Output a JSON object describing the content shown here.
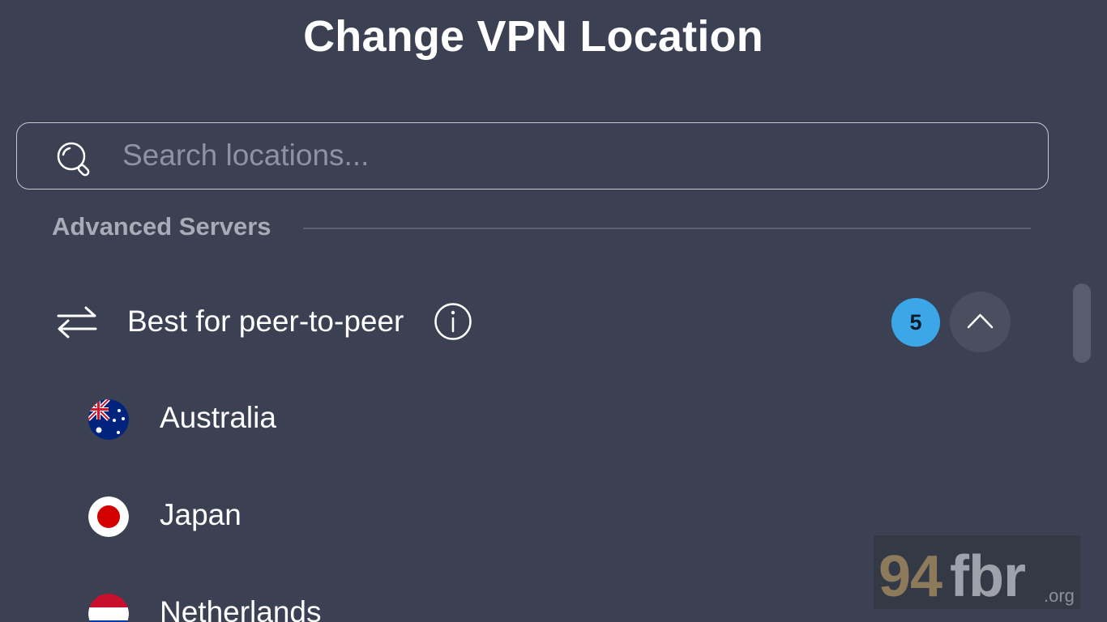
{
  "header": {
    "title": "Change VPN Location"
  },
  "search": {
    "placeholder": "Search locations...",
    "value": ""
  },
  "section": {
    "label": "Advanced Servers"
  },
  "group": {
    "label": "Best for peer-to-peer",
    "count": "5",
    "expanded": true,
    "icon": "p2p-arrows-icon"
  },
  "countries": [
    {
      "name": "Australia",
      "flag": "australia-flag"
    },
    {
      "name": "Japan",
      "flag": "japan-flag"
    },
    {
      "name": "Netherlands",
      "flag": "netherlands-flag"
    }
  ],
  "watermark": {
    "digits": "94",
    "letters": "fbr",
    "tld": ".org"
  },
  "colors": {
    "background": "#3b4052",
    "badge": "#3ba7e9",
    "muted_text": "#a8acb7"
  }
}
